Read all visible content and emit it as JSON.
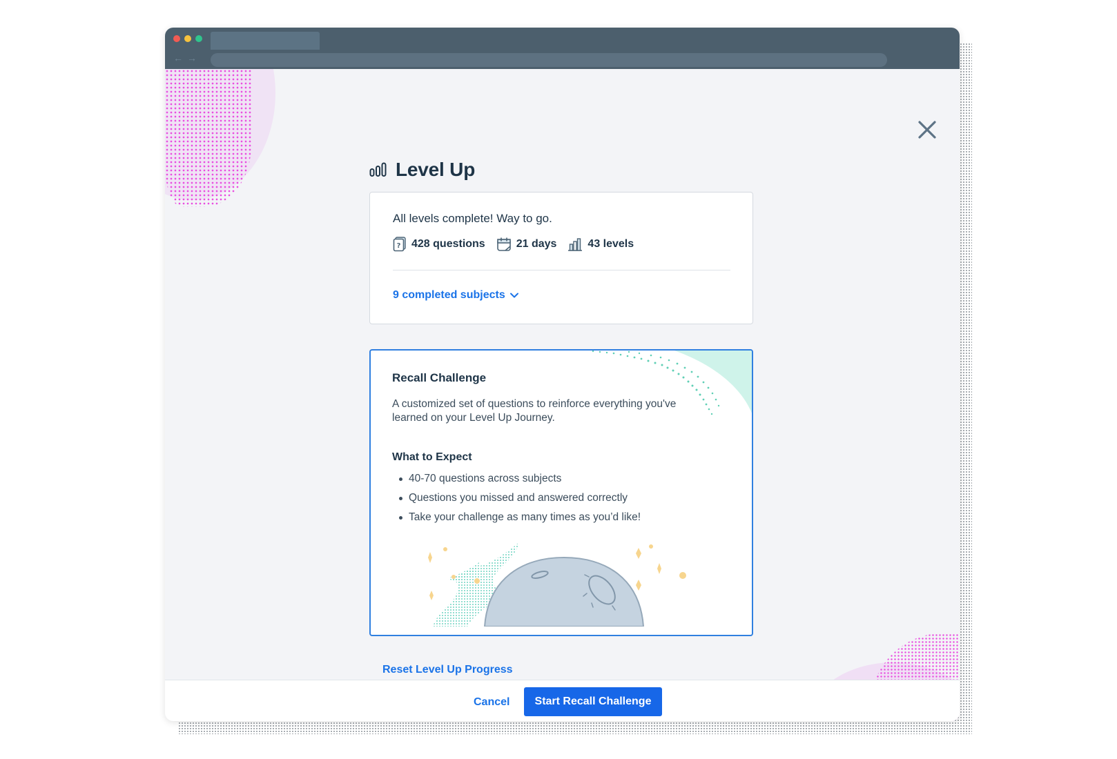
{
  "browser": {
    "light_colors": [
      "#f25b53",
      "#f6c23e",
      "#30c48d"
    ],
    "back_arrow": "←",
    "forward_arrow": "→"
  },
  "modal": {
    "title": "Level Up",
    "title_icon": "level-bars-icon",
    "close_icon": "close-icon"
  },
  "progress_card": {
    "headline": "All levels complete! Way to go.",
    "stats": [
      {
        "icon": "question-card-icon",
        "label": "428 questions"
      },
      {
        "icon": "calendar-icon",
        "label": "21 days"
      },
      {
        "icon": "bar-chart-icon",
        "label": "43 levels"
      }
    ],
    "subjects_link": "9 completed subjects"
  },
  "recall_card": {
    "title": "Recall Challenge",
    "description": "A customized set of questions to reinforce everything you've learned on your Level Up Journey.",
    "expect_heading": "What to Expect",
    "bullets": [
      "40-70 questions across subjects",
      "Questions you missed and answered correctly",
      "Take your challenge as many times as you’d like!"
    ]
  },
  "reset_link": "Reset Level Up Progress",
  "footer": {
    "cancel_label": "Cancel",
    "start_label": "Start Recall Challenge"
  },
  "colors": {
    "accent": "#1767e8",
    "link": "#1a73e8",
    "card_border_active": "#2f7fe0",
    "text_dark": "#1e3447"
  }
}
